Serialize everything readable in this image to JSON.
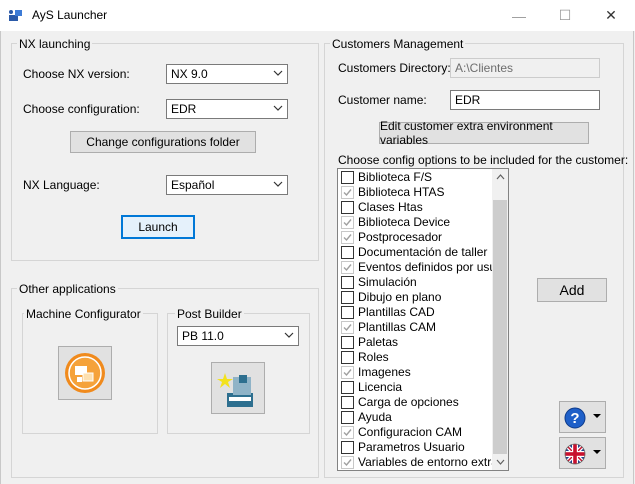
{
  "window": {
    "title": "AyS Launcher",
    "minimize_glyph": "—",
    "maximize_glyph": "☐",
    "close_glyph": "✕"
  },
  "nx_launching": {
    "legend": "NX launching",
    "version_label": "Choose NX version:",
    "version_value": "NX 9.0",
    "config_label": "Choose configuration:",
    "config_value": "EDR",
    "change_folder_button": "Change configurations folder",
    "language_label": "NX Language:",
    "language_value": "Español",
    "launch_button": "Launch"
  },
  "other_apps": {
    "legend": "Other applications",
    "machine_configurator_legend": "Machine Configurator",
    "post_builder_legend": "Post Builder",
    "post_builder_value": "PB 11.0"
  },
  "customers": {
    "legend": "Customers Management",
    "directory_label": "Customers Directory:",
    "directory_value": "A:\\Clientes",
    "name_label": "Customer name:",
    "name_value": "EDR",
    "edit_env_button": "Edit customer extra environment variables",
    "options_label": "Choose config options to be included for the customer:",
    "add_button": "Add",
    "options": [
      {
        "label": "Biblioteca F/S",
        "checked": false
      },
      {
        "label": "Biblioteca HTAS",
        "checked": true
      },
      {
        "label": "Clases Htas",
        "checked": false
      },
      {
        "label": "Biblioteca Device",
        "checked": true
      },
      {
        "label": "Postprocesador",
        "checked": true
      },
      {
        "label": "Documentación de taller",
        "checked": false
      },
      {
        "label": "Eventos definidos por usuario",
        "checked": true
      },
      {
        "label": "Simulación",
        "checked": false
      },
      {
        "label": "Dibujo en plano",
        "checked": false
      },
      {
        "label": "Plantillas CAD",
        "checked": false
      },
      {
        "label": "Plantillas CAM",
        "checked": true
      },
      {
        "label": "Paletas",
        "checked": false
      },
      {
        "label": "Roles",
        "checked": false
      },
      {
        "label": "Imagenes",
        "checked": true
      },
      {
        "label": "Licencia",
        "checked": false
      },
      {
        "label": "Carga de opciones",
        "checked": false
      },
      {
        "label": "Ayuda",
        "checked": false
      },
      {
        "label": "Configuracion CAM",
        "checked": true
      },
      {
        "label": "Parametros Usuario",
        "checked": false
      },
      {
        "label": "Variables de entorno extra",
        "checked": true
      }
    ]
  },
  "icons": {
    "help": "help-icon",
    "language_flag": "uk-flag-icon",
    "machine_configurator": "machine-configurator-icon",
    "post_builder": "post-builder-icon"
  },
  "colors": {
    "accent": "#0078d7",
    "help_blue": "#1e5fc8",
    "orange": "#f08a1c"
  }
}
